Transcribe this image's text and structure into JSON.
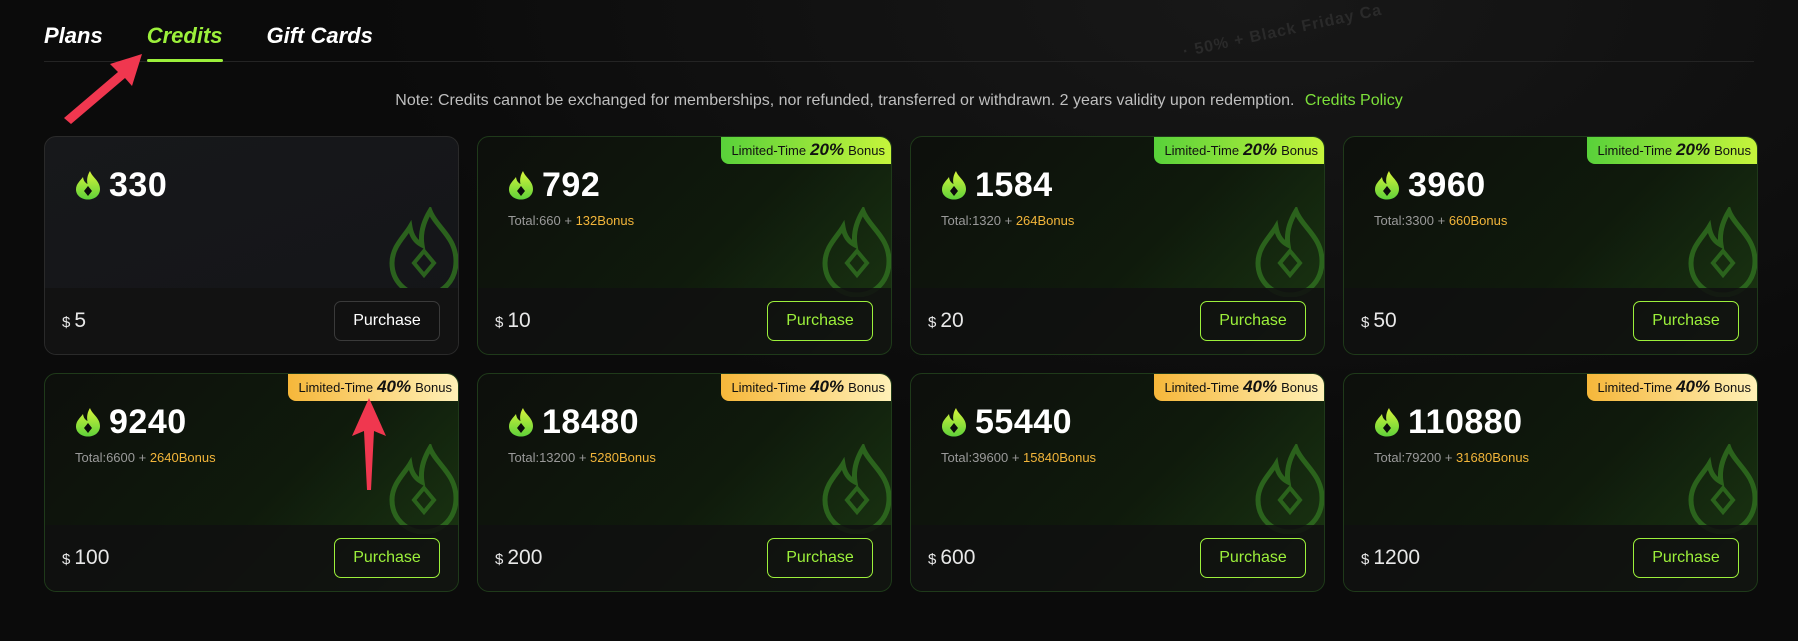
{
  "tabs": [
    {
      "label": "Plans",
      "active": false
    },
    {
      "label": "Credits",
      "active": true
    },
    {
      "label": "Gift Cards",
      "active": false
    }
  ],
  "banner_text": "· 50% + Black Friday Ca",
  "note": {
    "text": "Note: Credits cannot be exchanged for memberships, nor refunded, transferred or withdrawn. 2 years validity upon redemption.",
    "link": "Credits Policy"
  },
  "icons": {
    "credit": "flame-icon",
    "decoration": "flame-diamond-icon"
  },
  "colors": {
    "accent": "#9cf03b",
    "bonus": "#f2b53a",
    "badge_green": "#58d13a",
    "badge_gold": "#f6b73a",
    "annotation_arrow": "#f0374f"
  },
  "cards": [
    {
      "credits": "330",
      "total": "",
      "bonus": "",
      "currency": "$",
      "price": "5",
      "button": "Purchase",
      "badge": null
    },
    {
      "credits": "792",
      "total": "Total:660 + ",
      "bonus": "132Bonus",
      "currency": "$",
      "price": "10",
      "button": "Purchase",
      "badge": {
        "prefix": "Limited-Time",
        "percent": "20%",
        "suffix": "Bonus",
        "style": "green"
      }
    },
    {
      "credits": "1584",
      "total": "Total:1320 + ",
      "bonus": "264Bonus",
      "currency": "$",
      "price": "20",
      "button": "Purchase",
      "badge": {
        "prefix": "Limited-Time",
        "percent": "20%",
        "suffix": "Bonus",
        "style": "green"
      }
    },
    {
      "credits": "3960",
      "total": "Total:3300 + ",
      "bonus": "660Bonus",
      "currency": "$",
      "price": "50",
      "button": "Purchase",
      "badge": {
        "prefix": "Limited-Time",
        "percent": "20%",
        "suffix": "Bonus",
        "style": "green"
      }
    },
    {
      "credits": "9240",
      "total": "Total:6600 + ",
      "bonus": "2640Bonus",
      "currency": "$",
      "price": "100",
      "button": "Purchase",
      "badge": {
        "prefix": "Limited-Time",
        "percent": "40%",
        "suffix": "Bonus",
        "style": "gold"
      }
    },
    {
      "credits": "18480",
      "total": "Total:13200 + ",
      "bonus": "5280Bonus",
      "currency": "$",
      "price": "200",
      "button": "Purchase",
      "badge": {
        "prefix": "Limited-Time",
        "percent": "40%",
        "suffix": "Bonus",
        "style": "gold"
      }
    },
    {
      "credits": "55440",
      "total": "Total:39600 + ",
      "bonus": "15840Bonus",
      "currency": "$",
      "price": "600",
      "button": "Purchase",
      "badge": {
        "prefix": "Limited-Time",
        "percent": "40%",
        "suffix": "Bonus",
        "style": "gold"
      }
    },
    {
      "credits": "110880",
      "total": "Total:79200 + ",
      "bonus": "31680Bonus",
      "currency": "$",
      "price": "1200",
      "button": "Purchase",
      "badge": {
        "prefix": "Limited-Time",
        "percent": "40%",
        "suffix": "Bonus",
        "style": "gold"
      }
    }
  ]
}
